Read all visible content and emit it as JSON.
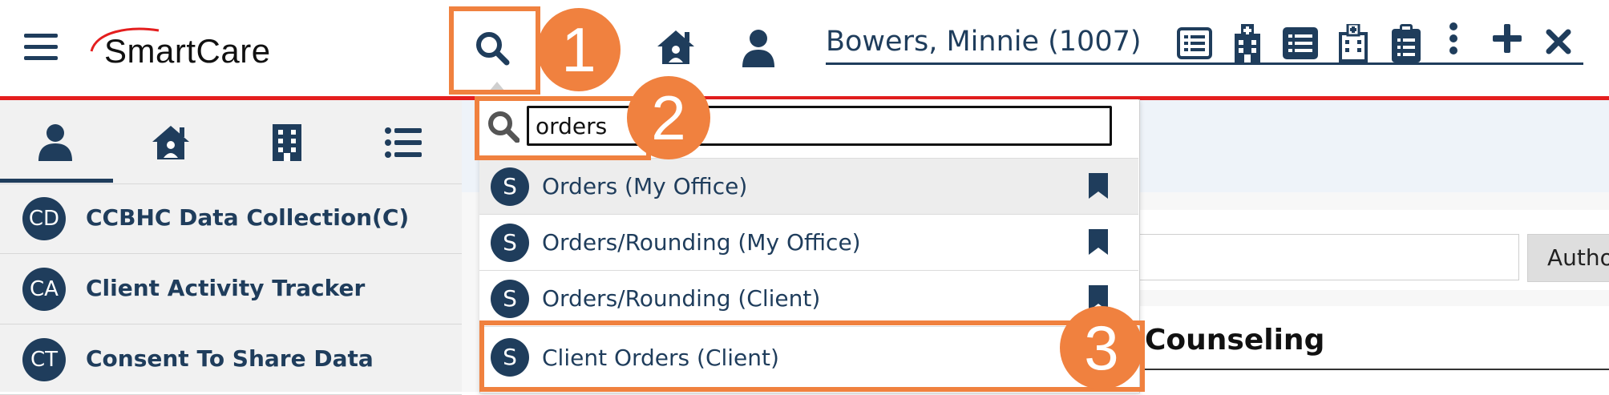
{
  "header": {
    "logo_text": "SmartCare",
    "client_name": "Bowers, Minnie (1007)"
  },
  "left_panel": {
    "items": [
      {
        "initials": "CD",
        "label": "CCBHC Data Collection(C)"
      },
      {
        "initials": "CA",
        "label": "Client Activity Tracker"
      },
      {
        "initials": "CT",
        "label": "Consent To Share Data"
      }
    ]
  },
  "search": {
    "value": "orders",
    "results": [
      {
        "badge": "S",
        "label": "Orders (My Office)"
      },
      {
        "badge": "S",
        "label": "Orders/Rounding (My Office)"
      },
      {
        "badge": "S",
        "label": "Orders/Rounding (Client)"
      },
      {
        "badge": "S",
        "label": "Client Orders (Client)"
      }
    ]
  },
  "content": {
    "author_button": "Autho",
    "section_title": "Counseling"
  },
  "annotations": {
    "step1": "1",
    "step2": "2",
    "step3": "3"
  },
  "colors": {
    "brand_navy": "#1f3d5c",
    "accent_red": "#e41e1e",
    "callout_orange": "#f0813f"
  }
}
